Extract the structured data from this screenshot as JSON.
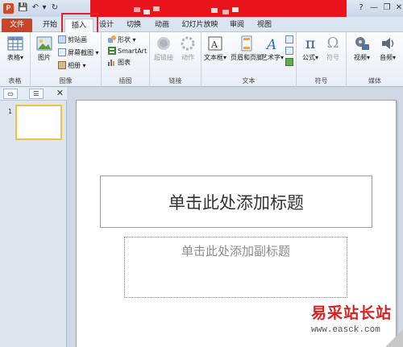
{
  "app": {
    "icon_letter": "P"
  },
  "qat": {
    "save": "💾",
    "undo": "↶",
    "undo_arrow": "▾",
    "redo": "↻"
  },
  "window": {
    "help": "?",
    "minimize": "—",
    "restore": "❐",
    "close": "✕"
  },
  "tabs": [
    {
      "label": "文件"
    },
    {
      "label": "开始"
    },
    {
      "label": "插入"
    },
    {
      "label": "设计"
    },
    {
      "label": "切换"
    },
    {
      "label": "动画"
    },
    {
      "label": "幻灯片放映"
    },
    {
      "label": "审阅"
    },
    {
      "label": "视图"
    }
  ],
  "ribbon": {
    "groups": {
      "table": {
        "label": "表格",
        "table_btn": "表格"
      },
      "images": {
        "label": "图像",
        "picture_btn": "图片",
        "clipart": "剪贴画",
        "screenshot": "屏幕截图",
        "album": "相册"
      },
      "illustrations": {
        "label": "插图",
        "shapes": "形状",
        "smartart": "SmartArt",
        "chart": "图表"
      },
      "links": {
        "label": "链接",
        "hyperlink": "超链接",
        "action": "动作"
      },
      "text": {
        "label": "文本",
        "textbox": "文本框",
        "header_footer": "页眉和页脚",
        "wordart": "艺术字"
      },
      "symbols": {
        "label": "符号",
        "equation": "公式",
        "symbol": "符号",
        "equation_glyph": "π",
        "symbol_glyph": "Ω"
      },
      "media": {
        "label": "媒体",
        "video": "视频",
        "audio": "音频"
      }
    }
  },
  "pane": {
    "tab1": "▭",
    "tab2": "☰",
    "close": "✕",
    "slide_number": "1"
  },
  "slide": {
    "title_placeholder": "单击此处添加标题",
    "subtitle_placeholder": "单击此处添加副标题"
  },
  "watermark": {
    "title": "易采站长站",
    "url": "www.easck.com"
  }
}
